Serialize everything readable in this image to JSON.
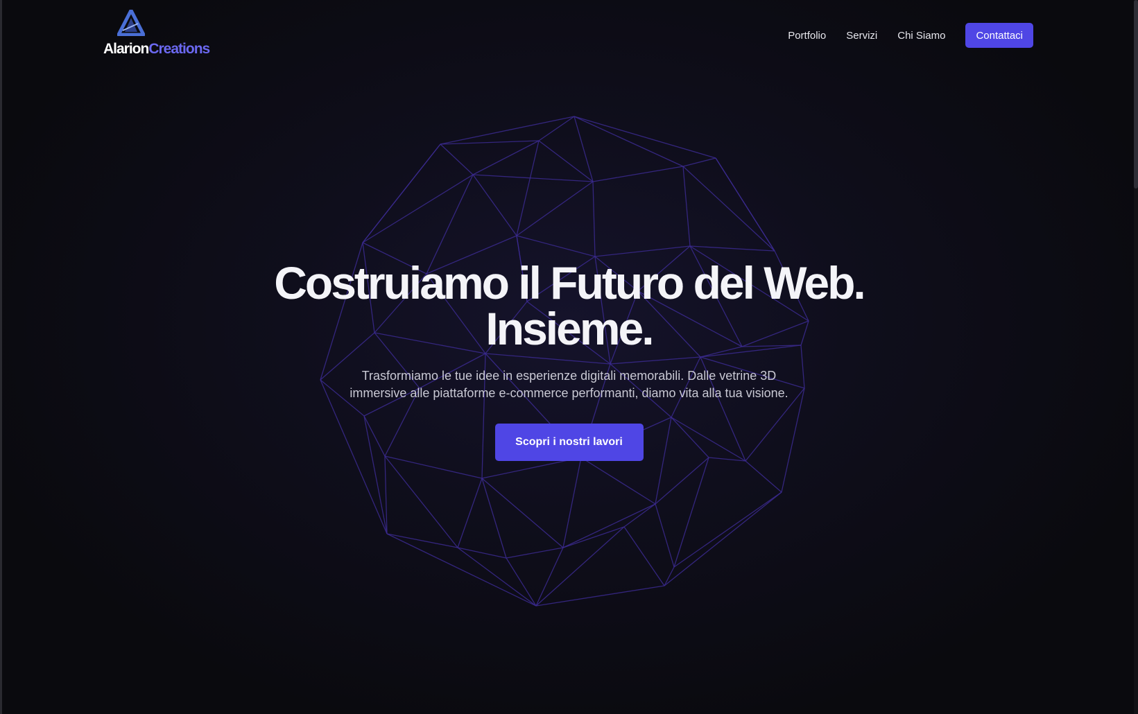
{
  "brand": {
    "name_part1": "Alarion",
    "name_part2": "Creations",
    "logo_icon": "a-triangle-logo-icon"
  },
  "nav": {
    "items": [
      {
        "label": "Portfolio"
      },
      {
        "label": "Servizi"
      },
      {
        "label": "Chi Siamo"
      }
    ],
    "cta_label": "Contattaci"
  },
  "hero": {
    "title_line1": "Costruiamo il Futuro del Web.",
    "title_line2": "Insieme.",
    "subtitle_line1": "Trasformiamo le tue idee in esperienze digitali memorabili. Dalle vetrine 3D",
    "subtitle_line2": "immersive alle piattaforme e-commerce performanti, diamo vita alla tua visione.",
    "button_label": "Scopri i nostri lavori",
    "background_graphic": "wireframe-sphere"
  },
  "colors": {
    "accent": "#4f46e5",
    "brand_blue": "#6b68f0",
    "background": "#0b0b0f",
    "wireframe": "#3a2a8c"
  }
}
